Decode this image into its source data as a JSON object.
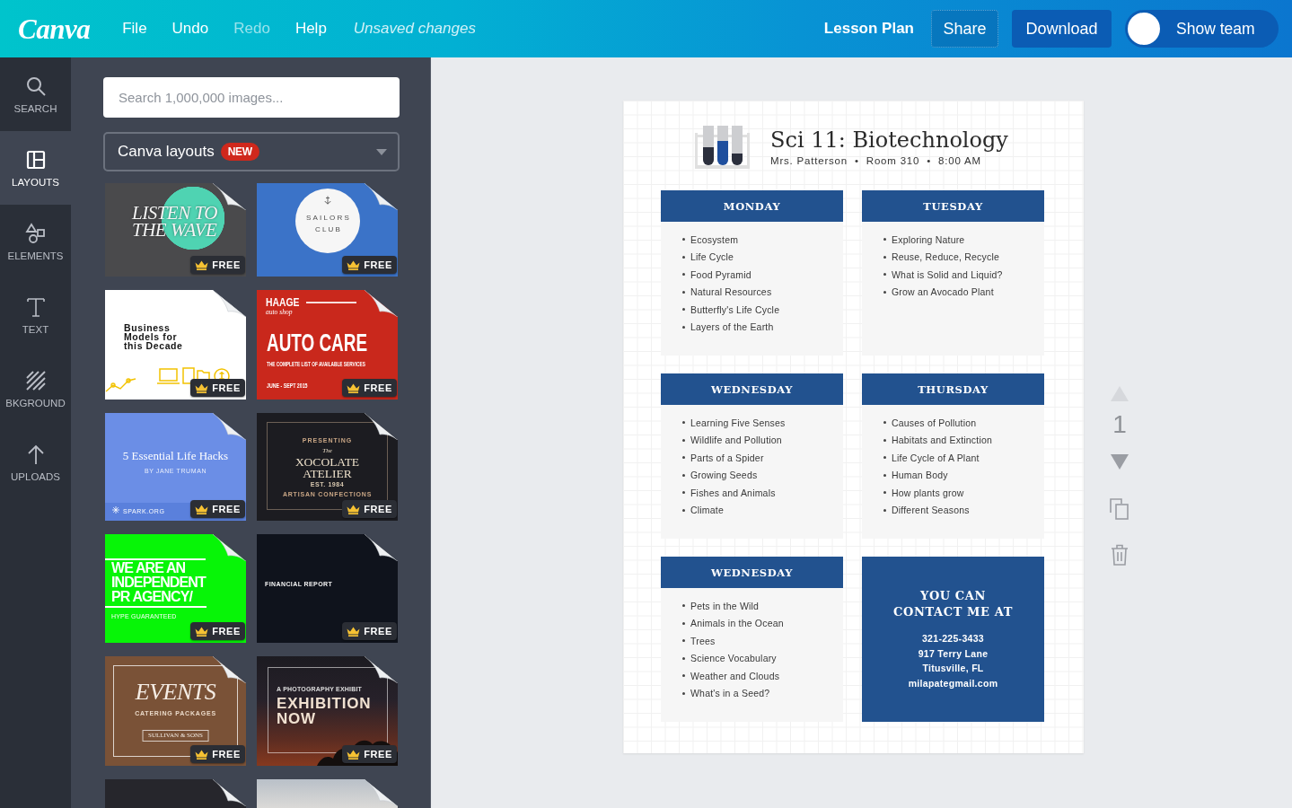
{
  "topbar": {
    "logo": "Canva",
    "menu": [
      {
        "label": "File",
        "disabled": false
      },
      {
        "label": "Undo",
        "disabled": false
      },
      {
        "label": "Redo",
        "disabled": true
      },
      {
        "label": "Help",
        "disabled": false
      }
    ],
    "status": "Unsaved changes",
    "document_name": "Lesson Plan",
    "buttons": [
      {
        "label": "Share",
        "kind": "share"
      },
      {
        "label": "Download",
        "kind": "download"
      }
    ],
    "team_toggle": {
      "label": "Show team",
      "on": false
    }
  },
  "sidebar": {
    "items": [
      {
        "label": "SEARCH",
        "kind": "search",
        "selected": false
      },
      {
        "label": "LAYOUTS",
        "kind": "layouts",
        "selected": true
      },
      {
        "label": "ELEMENTS",
        "kind": "elements",
        "selected": false
      },
      {
        "label": "TEXT",
        "kind": "text",
        "selected": false
      },
      {
        "label": "BKGROUND",
        "kind": "background",
        "selected": false
      },
      {
        "label": "UPLOADS",
        "kind": "uploads",
        "selected": false
      }
    ]
  },
  "panel": {
    "search": {
      "placeholder": "Search 1,000,000 images..."
    },
    "dropdown": {
      "value": "Canva layouts",
      "badge": "NEW"
    },
    "layout_rows": [
      [
        {
          "kind": "wave",
          "texts": [
            "LISTEN TO THE WAVE"
          ],
          "badge": "FREE"
        },
        {
          "kind": "sailors",
          "texts": [
            "SAILORS CLUB"
          ],
          "badge": "FREE"
        }
      ],
      [
        {
          "kind": "business",
          "texts": [
            "Business Models for this Decade"
          ],
          "badge": "FREE"
        },
        {
          "kind": "autocare",
          "texts": [
            "HAAGE",
            "auto shop",
            "AUTO CARE",
            "THE COMPLETE LIST OF AVAILABLE SERVICES",
            "JUNE - SEPT 2015"
          ],
          "badge": "FREE"
        }
      ],
      [
        {
          "kind": "lifehacks",
          "texts": [
            "5 Essential Life Hacks",
            "BY JANE TRUMAN",
            "SPARK.ORG"
          ],
          "badge": "FREE"
        },
        {
          "kind": "xocolate",
          "texts": [
            "PRESENTING",
            "The",
            "XOCOLATE ATELIER",
            "EST. 1984",
            "ARTISAN CONFECTIONS"
          ],
          "badge": "FREE"
        }
      ],
      [
        {
          "kind": "agency",
          "texts": [
            "WE ARE AN INDEPENDENT PR AGENCY/",
            "HYPE GUARANTEED"
          ],
          "badge": "FREE"
        },
        {
          "kind": "financial",
          "texts": [
            "FINANCIAL REPORT"
          ],
          "badge": "FREE"
        }
      ],
      [
        {
          "kind": "events",
          "texts": [
            "EVENTS",
            "CATERING PACKAGES",
            "SULLIVAN & SONS"
          ],
          "badge": "FREE"
        },
        {
          "kind": "exhibition",
          "texts": [
            "A PHOTOGRAPHY EXHIBIT",
            "EXHIBITION NOW"
          ],
          "badge": "FREE"
        }
      ],
      [
        {
          "kind": "dark"
        },
        {
          "kind": "clouds"
        }
      ]
    ]
  },
  "document": {
    "title": "Sci 11: Biotechnology",
    "subtitle": "Mrs. Patterson  •  Room 310  •  8:00 AM",
    "cards": [
      {
        "kind": "day",
        "heading": "MONDAY",
        "items": [
          "Ecosystem",
          "Life Cycle",
          "Food Pyramid",
          "Natural Resources",
          "Butterfly's Life Cycle",
          "Layers of the Earth"
        ]
      },
      {
        "kind": "day",
        "heading": "TUESDAY",
        "items": [
          "Exploring Nature",
          "Reuse, Reduce, Recycle",
          "What is Solid and Liquid?",
          "Grow an Avocado Plant"
        ]
      },
      {
        "kind": "day",
        "heading": "WEDNESDAY",
        "items": [
          "Learning Five Senses",
          "Wildlife and Pollution",
          "Parts of a Spider",
          "Growing Seeds",
          "Fishes and Animals",
          "Climate"
        ]
      },
      {
        "kind": "day",
        "heading": "THURSDAY",
        "items": [
          "Causes of Pollution",
          "Habitats and Extinction",
          "Life Cycle of A Plant",
          "Human Body",
          "How plants grow",
          "Different Seasons"
        ]
      },
      {
        "kind": "day",
        "heading": "WEDNESDAY",
        "items": [
          "Pets in the Wild",
          "Animals in the Ocean",
          "Trees",
          "Science Vocabulary",
          "Weather and Clouds",
          "What's in a Seed?"
        ]
      },
      {
        "kind": "contact",
        "heading": "YOU CAN CONTACT ME AT",
        "lines": [
          "321-225-3433",
          "917 Terry Lane",
          "Titusville, FL",
          "milapategmail.com"
        ]
      }
    ]
  },
  "page_tools": {
    "up": {
      "disabled": true
    },
    "page_number": "1",
    "down": {
      "disabled": false
    }
  }
}
